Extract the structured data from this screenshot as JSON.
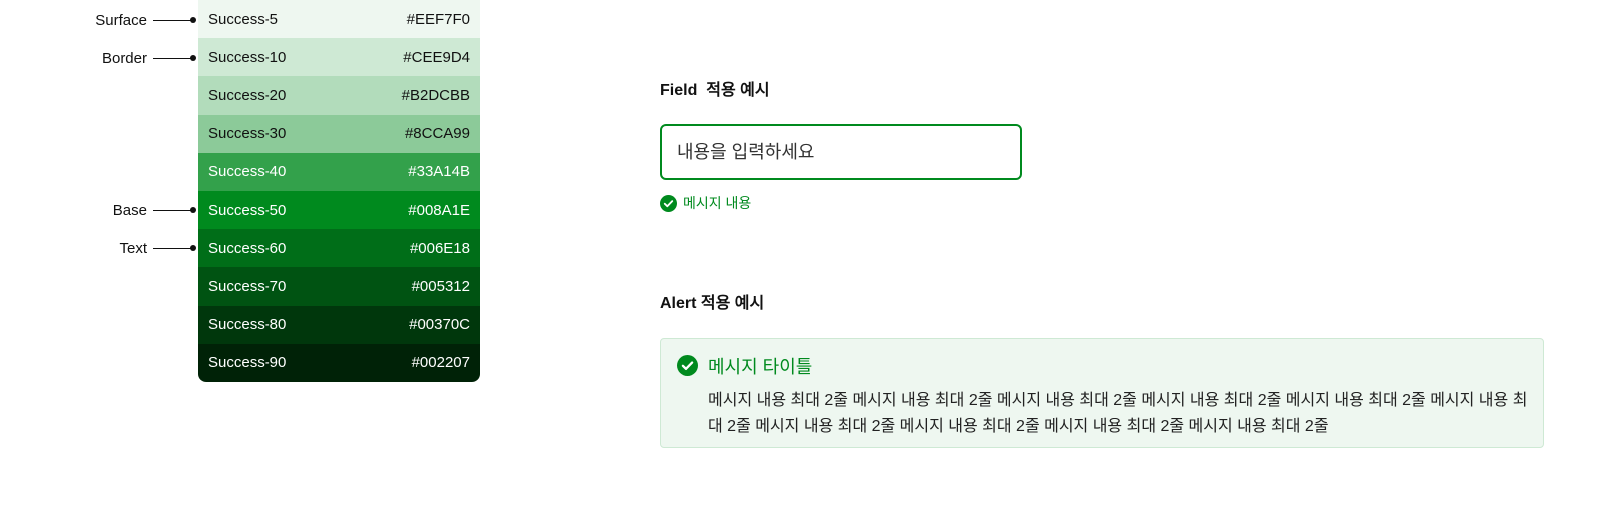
{
  "palette": [
    {
      "name": "Success-5",
      "hex": "#EEF7F0",
      "text_color": "#111111"
    },
    {
      "name": "Success-10",
      "hex": "#CEE9D4",
      "text_color": "#111111"
    },
    {
      "name": "Success-20",
      "hex": "#B2DCBB",
      "text_color": "#111111"
    },
    {
      "name": "Success-30",
      "hex": "#8CCA99",
      "text_color": "#111111"
    },
    {
      "name": "Success-40",
      "hex": "#33A14B",
      "text_color": "#ffffff"
    },
    {
      "name": "Success-50",
      "hex": "#008A1E",
      "text_color": "#ffffff"
    },
    {
      "name": "Success-60",
      "hex": "#006E18",
      "text_color": "#ffffff"
    },
    {
      "name": "Success-70",
      "hex": "#005312",
      "text_color": "#ffffff"
    },
    {
      "name": "Success-80",
      "hex": "#00370C",
      "text_color": "#ffffff"
    },
    {
      "name": "Success-90",
      "hex": "#002207",
      "text_color": "#ffffff"
    }
  ],
  "roles": {
    "surface": "Surface",
    "border": "Border",
    "base": "Base",
    "text": "Text"
  },
  "field_example": {
    "title": "Field  적용 예시",
    "placeholder": "내용을 입력하세요",
    "message": "메시지 내용",
    "icon": "check-circle-icon"
  },
  "alert_example": {
    "title": "Alert 적용 예시",
    "alert_title": "메시지 타이틀",
    "alert_body": "메시지 내용 최대 2줄 메시지 내용 최대 2줄 메시지 내용 최대 2줄 메시지 내용 최대 2줄 메시지 내용 최대 2줄 메시지 내용 최대 2줄 메시지 내용 최대 2줄 메시지 내용 최대 2줄 메시지 내용 최대 2줄 메시지 내용 최대 2줄",
    "icon": "check-circle-icon"
  },
  "colors": {
    "success_base": "#008A1E",
    "alert_background": "#EEF7F0",
    "alert_border": "#CEE9D4"
  }
}
